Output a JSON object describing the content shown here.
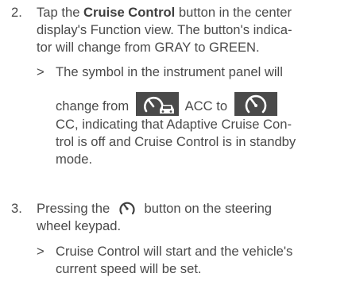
{
  "steps": [
    {
      "number": "2.",
      "line1_before": "Tap the ",
      "line1_bold": "Cruise Control",
      "line1_after": " button in the center",
      "line2": "display's Function view. The button's indica-",
      "line3": "tor will change from GRAY to GREEN.",
      "sub": {
        "marker": ">",
        "line1": "The symbol in the instrument panel will",
        "line2_a": "change from",
        "line2_b": "ACC to",
        "line3": "CC, indicating that Adaptive Cruise Con-",
        "line4": "trol is off and Cruise Control is in standby",
        "line5": "mode.",
        "icon_acc": "acc-speedometer-car-icon",
        "icon_cc": "cc-speedometer-icon"
      }
    },
    {
      "number": "3.",
      "line1_a": "Pressing the",
      "line1_b": "button on the steering",
      "line2": "wheel keypad.",
      "icon": "cruise-control-speedometer-icon",
      "sub": {
        "marker": ">",
        "line1": "Cruise Control will start and the vehicle's",
        "line2": "current speed will be set."
      }
    }
  ],
  "colors": {
    "text": "#4a4a4a",
    "icon_background": "#4a4a4a",
    "icon_foreground": "#ffffff"
  }
}
